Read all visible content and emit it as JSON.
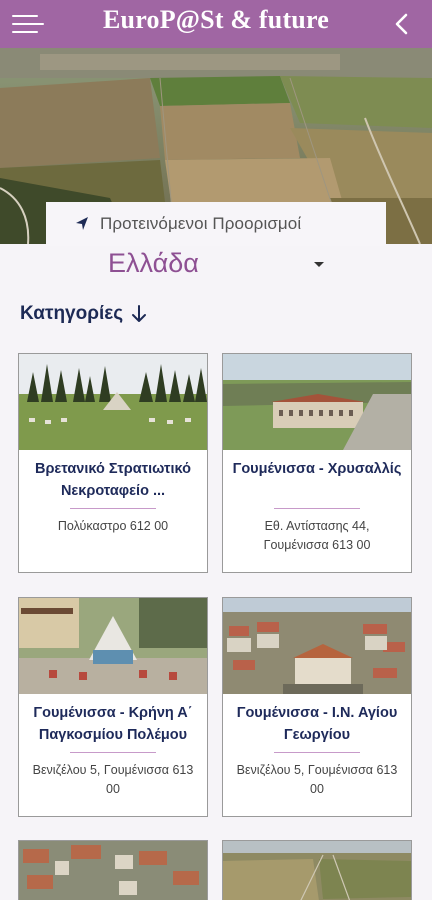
{
  "app": {
    "title": "EuroP@St & future"
  },
  "destinations": {
    "label": "Προτεινόμενοι Προορισμοί",
    "country": "Ελλάδα"
  },
  "categories": {
    "label": "Κατηγορίες"
  },
  "places": [
    {
      "title": "Βρετανικό Στρατιωτικό Νεκροταφείο ...",
      "address": "Πολύκαστρο 612 00"
    },
    {
      "title": "Γουμένισσα - Χρυσαλλίς",
      "address": "Εθ. Αντίστασης 44, Γουμένισσα 613 00"
    },
    {
      "title": "Γουμένισσα - Κρήνη Α΄ Παγκοσμίου Πολέμου",
      "address": "Βενιζέλου 5, Γουμένισσα 613 00"
    },
    {
      "title": "Γουμένισσα - Ι.Ν. Αγίου Γεωργίου",
      "address": "Βενιζέλου 5, Γουμένισσα 613 00"
    }
  ],
  "icons": {
    "menu": "hamburger-menu-icon",
    "back": "chevron-left-icon",
    "nav": "navigation-arrow-icon",
    "caret": "dropdown-caret-icon",
    "down": "arrow-down-icon"
  },
  "colors": {
    "appbar": "#a066a3",
    "accent": "#8e5093",
    "title": "#1e2a5a",
    "background": "#f6f4f8"
  }
}
